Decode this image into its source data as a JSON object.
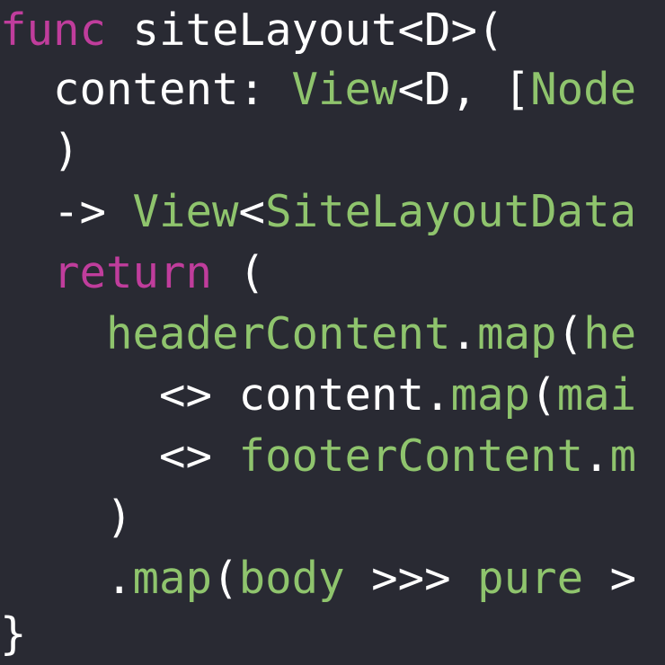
{
  "code_editor": {
    "lines": [
      {
        "indent": "",
        "tokens": [
          {
            "t": "func",
            "k": "keyword"
          },
          {
            "t": " siteLayout<D>(",
            "k": "plain"
          }
        ]
      },
      {
        "indent": "  ",
        "tokens": [
          {
            "t": "content: ",
            "k": "plain"
          },
          {
            "t": "View",
            "k": "type"
          },
          {
            "t": "<D, [",
            "k": "plain"
          },
          {
            "t": "Node",
            "k": "type"
          }
        ]
      },
      {
        "indent": "  ",
        "tokens": [
          {
            "t": ")",
            "k": "plain"
          }
        ]
      },
      {
        "indent": "  ",
        "tokens": [
          {
            "t": "-> ",
            "k": "plain"
          },
          {
            "t": "View",
            "k": "type"
          },
          {
            "t": "<",
            "k": "plain"
          },
          {
            "t": "SiteLayoutData",
            "k": "type"
          }
        ]
      },
      {
        "indent": "  ",
        "tokens": [
          {
            "t": "return",
            "k": "keyword"
          },
          {
            "t": " (",
            "k": "plain"
          }
        ]
      },
      {
        "indent": "    ",
        "tokens": [
          {
            "t": "headerContent",
            "k": "function"
          },
          {
            "t": ".",
            "k": "plain"
          },
          {
            "t": "map",
            "k": "function"
          },
          {
            "t": "(",
            "k": "plain"
          },
          {
            "t": "he",
            "k": "function"
          }
        ]
      },
      {
        "indent": "      ",
        "tokens": [
          {
            "t": "<> content.",
            "k": "plain"
          },
          {
            "t": "map",
            "k": "function"
          },
          {
            "t": "(",
            "k": "plain"
          },
          {
            "t": "mai",
            "k": "function"
          }
        ]
      },
      {
        "indent": "      ",
        "tokens": [
          {
            "t": "<> ",
            "k": "plain"
          },
          {
            "t": "footerContent",
            "k": "function"
          },
          {
            "t": ".",
            "k": "plain"
          },
          {
            "t": "m",
            "k": "function"
          }
        ]
      },
      {
        "indent": "    ",
        "tokens": [
          {
            "t": ")",
            "k": "plain"
          }
        ]
      },
      {
        "indent": "    ",
        "tokens": [
          {
            "t": ".",
            "k": "plain"
          },
          {
            "t": "map",
            "k": "function"
          },
          {
            "t": "(",
            "k": "plain"
          },
          {
            "t": "body",
            "k": "function"
          },
          {
            "t": " >>> ",
            "k": "plain"
          },
          {
            "t": "pure",
            "k": "function"
          },
          {
            "t": " >",
            "k": "plain"
          }
        ]
      },
      {
        "indent": "",
        "tokens": [
          {
            "t": "}",
            "k": "plain"
          }
        ]
      }
    ]
  },
  "colors": {
    "background": "#292a33",
    "keyword": "#c03d9c",
    "type": "#8fc46d",
    "function": "#8fc46d",
    "plain": "#ffffff"
  }
}
